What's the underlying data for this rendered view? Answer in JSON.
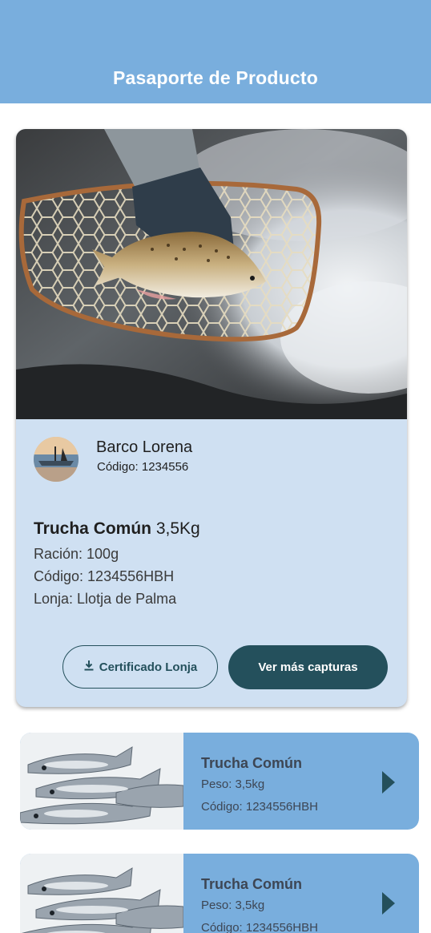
{
  "header": {
    "title": "Pasaporte de Producto"
  },
  "vessel": {
    "name": "Barco Lorena",
    "code": "Código: 1234556"
  },
  "product": {
    "name": "Trucha Común",
    "weight": "3,5Kg",
    "ration": "Ración: 100g",
    "code": "Código: 1234556HBH",
    "market": "Lonja: Llotja de Palma"
  },
  "actions": {
    "certificate_label": "Certificado Lonja",
    "more_label": "Ver más capturas"
  },
  "captures": [
    {
      "name": "Trucha Común",
      "weight": "Peso: 3,5kg",
      "code": "Código: 1234556HBH"
    },
    {
      "name": "Trucha Común",
      "weight": "Peso: 3,5kg",
      "code": "Código: 1234556HBH"
    }
  ],
  "colors": {
    "header": "#79aedd",
    "card": "#cfe0f2",
    "primary": "#24505c",
    "capture_card": "#79aedd"
  },
  "icons": [
    "download-icon",
    "chevron-right-icon"
  ]
}
